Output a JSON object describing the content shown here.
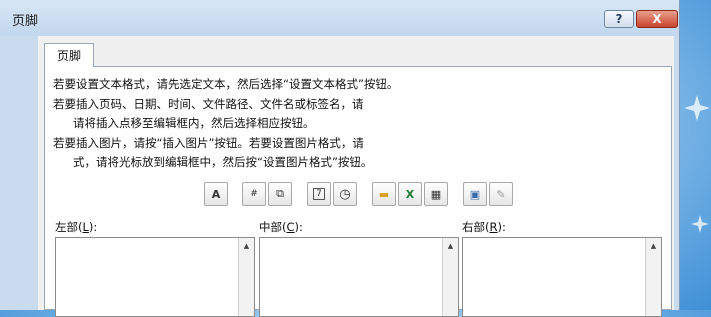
{
  "window": {
    "title": "页脚",
    "help_label": "?",
    "close_label": "X"
  },
  "tab": {
    "label": "页脚"
  },
  "instructions": [
    "若要设置文本格式，请先选定文本，然后选择“设置文本格式”按钮。",
    "若要插入页码、日期、时间、文件路径、文件名或标签名，请",
    "请将插入点移至编辑框内，然后选择相应按钮。",
    "若要插入图片，请按“插入图片”按钮。若要设置图片格式，请",
    "式，请将光标放到编辑框中，然后按“设置图片格式”按钮。"
  ],
  "toolbar": {
    "buttons": [
      {
        "name": "format-text",
        "icon": "A"
      },
      {
        "name": "insert-page-number",
        "icon": "#"
      },
      {
        "name": "insert-number-of-pages",
        "icon": "⧉"
      },
      {
        "name": "insert-date",
        "icon": "7"
      },
      {
        "name": "insert-time",
        "icon": "◷"
      },
      {
        "name": "insert-file-path",
        "icon": "▬"
      },
      {
        "name": "insert-file-name",
        "icon": "X"
      },
      {
        "name": "insert-sheet-name",
        "icon": "▦"
      },
      {
        "name": "insert-picture",
        "icon": "▣"
      },
      {
        "name": "format-picture",
        "icon": "✎"
      }
    ]
  },
  "sections": {
    "left": {
      "label_prefix": "左部(",
      "label_key": "L",
      "label_suffix": "):"
    },
    "center": {
      "label_prefix": "中部(",
      "label_key": "C",
      "label_suffix": "):"
    },
    "right": {
      "label_prefix": "右部(",
      "label_key": "R",
      "label_suffix": "):"
    }
  },
  "colors": {
    "desktop": "#63a7e0",
    "dialog_frame": "#c8dbef",
    "close_button": "#c8432e"
  }
}
